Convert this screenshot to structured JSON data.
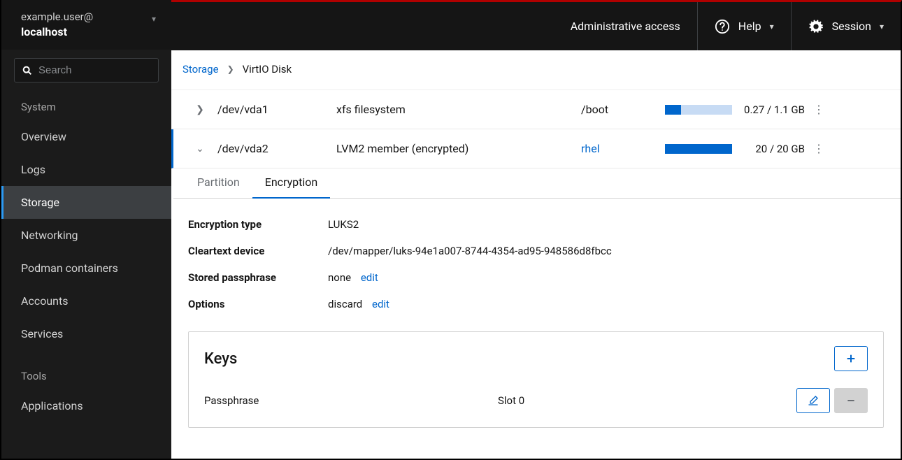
{
  "sidebar": {
    "user_at": "example.user@",
    "host": "localhost",
    "search_placeholder": "Search",
    "section_system": "System",
    "items": [
      {
        "label": "Overview"
      },
      {
        "label": "Logs"
      },
      {
        "label": "Storage"
      },
      {
        "label": "Networking"
      },
      {
        "label": "Podman containers"
      },
      {
        "label": "Accounts"
      },
      {
        "label": "Services"
      }
    ],
    "section_tools": "Tools",
    "tools": [
      {
        "label": "Applications"
      }
    ]
  },
  "topbar": {
    "admin_access": "Administrative access",
    "help": "Help",
    "session": "Session"
  },
  "breadcrumb": {
    "parent": "Storage",
    "current": "VirtIO Disk"
  },
  "partitions": [
    {
      "device": "/dev/vda1",
      "type": "xfs filesystem",
      "mount": "/boot",
      "mount_link": false,
      "size": "0.27 / 1.1 GB",
      "usage_pct": 24,
      "expanded": false
    },
    {
      "device": "/dev/vda2",
      "type": "LVM2 member (encrypted)",
      "mount": "rhel",
      "mount_link": true,
      "size": "20 / 20 GB",
      "usage_pct": 100,
      "expanded": true
    }
  ],
  "tabs": [
    {
      "label": "Partition",
      "active": false
    },
    {
      "label": "Encryption",
      "active": true
    }
  ],
  "encryption": {
    "type_label": "Encryption type",
    "type_value": "LUKS2",
    "cleartext_label": "Cleartext device",
    "cleartext_value": "/dev/mapper/luks-94e1a007-8744-4354-ad95-948586d8fbcc",
    "passphrase_label": "Stored passphrase",
    "passphrase_value": "none",
    "passphrase_edit": "edit",
    "options_label": "Options",
    "options_value": "discard",
    "options_edit": "edit"
  },
  "keys": {
    "heading": "Keys",
    "row_type": "Passphrase",
    "row_slot": "Slot 0"
  }
}
